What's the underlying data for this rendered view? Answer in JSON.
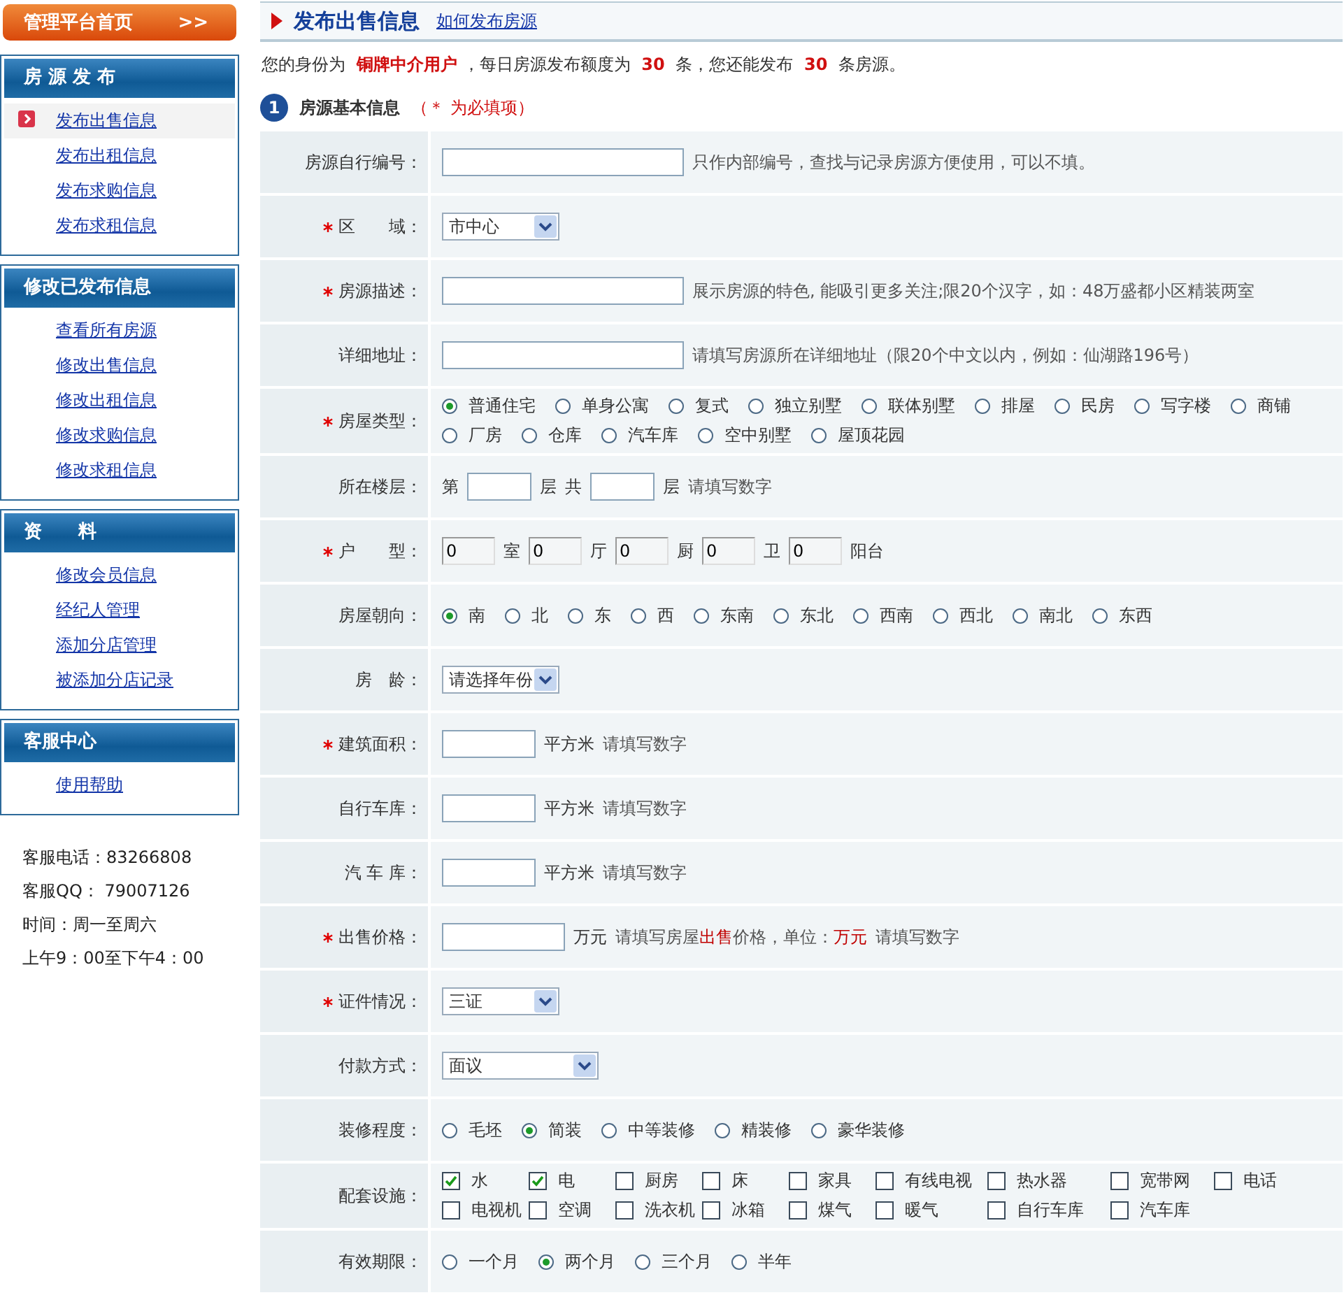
{
  "sidebar": {
    "home_button": {
      "label": "管理平台首页",
      "arrow": ">>"
    },
    "sections": [
      {
        "title": "房 源 发 布",
        "items": [
          {
            "label": "发布出售信息",
            "selected": true
          },
          {
            "label": "发布出租信息",
            "selected": false
          },
          {
            "label": "发布求购信息",
            "selected": false
          },
          {
            "label": "发布求租信息",
            "selected": false
          }
        ]
      },
      {
        "title": "修改已发布信息",
        "items": [
          {
            "label": "查看所有房源",
            "selected": false
          },
          {
            "label": "修改出售信息",
            "selected": false
          },
          {
            "label": "修改出租信息",
            "selected": false
          },
          {
            "label": "修改求购信息",
            "selected": false
          },
          {
            "label": "修改求租信息",
            "selected": false
          }
        ]
      },
      {
        "title": "资　　料",
        "items": [
          {
            "label": "修改会员信息",
            "selected": false
          },
          {
            "label": "经纪人管理",
            "selected": false
          },
          {
            "label": "添加分店管理",
            "selected": false
          },
          {
            "label": "被添加分店记录",
            "selected": false
          }
        ]
      },
      {
        "title": "客服中心",
        "items": [
          {
            "label": "使用帮助",
            "selected": false
          }
        ]
      }
    ],
    "contact": [
      "客服电话：83266808",
      "客服QQ：  79007126",
      "时间：周一至周六",
      "上午9：00至下午4：00"
    ]
  },
  "page": {
    "title": "发布出售信息",
    "help_link": "如何发布房源",
    "notice": "您的身份为 **铜牌中介用户**，每日房源发布额度为 **30** 条，您还能发布 **30** 条房源。",
    "section": {
      "number": "1",
      "title": "房源基本信息",
      "note": "（＊ 为必填项）"
    }
  },
  "form": [
    {
      "label": "房源自行编号：",
      "required": false,
      "parts": [
        {
          "kind": "wide-input"
        },
        {
          "kind": "hint",
          "text": "只作内部编号，查找与记录房源方便使用，可以不填。"
        }
      ]
    },
    {
      "label": "区　　域：",
      "required": true,
      "parts": [
        {
          "kind": "select",
          "value": "市中心"
        }
      ]
    },
    {
      "label": "房源描述：",
      "required": true,
      "parts": [
        {
          "kind": "wide-input"
        },
        {
          "kind": "hint",
          "text": "展示房源的特色, 能吸引更多关注;限20个汉字，如：48万盛都小区精装两室"
        }
      ]
    },
    {
      "label": "详细地址：",
      "required": false,
      "parts": [
        {
          "kind": "wide-input"
        },
        {
          "kind": "hint",
          "text": "请填写房源所在详细地址（限20个中文以内，例如：仙湖路196号）"
        }
      ]
    },
    {
      "label": "房屋类型：",
      "required": true,
      "parts": [
        {
          "kind": "radio",
          "options": [
            {
              "label": "普通住宅",
              "selected": true
            },
            {
              "label": "单身公寓",
              "selected": false
            },
            {
              "label": "复式",
              "selected": false
            },
            {
              "label": "独立别墅",
              "selected": false
            },
            {
              "label": "联体别墅",
              "selected": false
            },
            {
              "label": "排屋",
              "selected": false
            },
            {
              "label": "民房",
              "selected": false
            },
            {
              "label": "写字楼",
              "selected": false
            },
            {
              "label": "商铺",
              "selected": false
            },
            {
              "label": "厂房",
              "selected": false
            },
            {
              "label": "仓库",
              "selected": false
            },
            {
              "label": "汽车库",
              "selected": false
            },
            {
              "label": "空中别墅",
              "selected": false
            },
            {
              "label": "屋顶花园",
              "selected": false
            }
          ]
        }
      ]
    },
    {
      "label": "所在楼层：",
      "required": false,
      "parts": [
        {
          "kind": "text",
          "text": "第"
        },
        {
          "kind": "short-input"
        },
        {
          "kind": "text",
          "text": "层"
        },
        {
          "kind": "text",
          "text": "共"
        },
        {
          "kind": "short-input"
        },
        {
          "kind": "text",
          "text": "层"
        },
        {
          "kind": "hint",
          "text": "请填写数字"
        }
      ]
    },
    {
      "label": "户　　型：",
      "required": true,
      "parts": [
        {
          "kind": "tiny-input",
          "value": "0"
        },
        {
          "kind": "text",
          "text": "室"
        },
        {
          "kind": "tiny-input",
          "value": "0"
        },
        {
          "kind": "text",
          "text": "厅"
        },
        {
          "kind": "tiny-input",
          "value": "0"
        },
        {
          "kind": "text",
          "text": "厨"
        },
        {
          "kind": "tiny-input",
          "value": "0"
        },
        {
          "kind": "text",
          "text": "卫"
        },
        {
          "kind": "tiny-input",
          "value": "0"
        },
        {
          "kind": "text",
          "text": "阳台"
        }
      ]
    },
    {
      "label": "房屋朝向：",
      "required": false,
      "parts": [
        {
          "kind": "radio",
          "options": [
            {
              "label": "南",
              "selected": true
            },
            {
              "label": "北",
              "selected": false
            },
            {
              "label": "东",
              "selected": false
            },
            {
              "label": "西",
              "selected": false
            },
            {
              "label": "东南",
              "selected": false
            },
            {
              "label": "东北",
              "selected": false
            },
            {
              "label": "西南",
              "selected": false
            },
            {
              "label": "西北",
              "selected": false
            },
            {
              "label": "南北",
              "selected": false
            },
            {
              "label": "东西",
              "selected": false
            }
          ]
        }
      ]
    },
    {
      "label": "房　龄：",
      "required": false,
      "parts": [
        {
          "kind": "select",
          "value": "请选择年份"
        }
      ]
    },
    {
      "label": "建筑面积：",
      "required": true,
      "parts": [
        {
          "kind": "medium-input"
        },
        {
          "kind": "text",
          "text": "平方米"
        },
        {
          "kind": "hint",
          "text": "请填写数字"
        }
      ]
    },
    {
      "label": "自行车库：",
      "required": false,
      "parts": [
        {
          "kind": "medium-input"
        },
        {
          "kind": "text",
          "text": "平方米"
        },
        {
          "kind": "hint",
          "text": "请填写数字"
        }
      ]
    },
    {
      "label": "汽 车 库：",
      "required": false,
      "parts": [
        {
          "kind": "medium-input"
        },
        {
          "kind": "text",
          "text": "平方米"
        },
        {
          "kind": "hint",
          "text": "请填写数字"
        }
      ]
    },
    {
      "label": "出售价格：",
      "required": true,
      "parts": [
        {
          "kind": "price-input"
        },
        {
          "kind": "text",
          "text": "万元"
        },
        {
          "kind": "hint",
          "text": "请填写房屋**出售**价格，单位：**万元**"
        },
        {
          "kind": "hint",
          "text": "请填写数字"
        }
      ]
    },
    {
      "label": "证件情况：",
      "required": true,
      "parts": [
        {
          "kind": "select",
          "value": "三证"
        }
      ]
    },
    {
      "label": "付款方式：",
      "required": false,
      "parts": [
        {
          "kind": "wide-select",
          "value": "面议"
        }
      ]
    },
    {
      "label": "装修程度：",
      "required": false,
      "parts": [
        {
          "kind": "radio",
          "options": [
            {
              "label": "毛坯",
              "selected": false
            },
            {
              "label": "简装",
              "selected": true
            },
            {
              "label": "中等装修",
              "selected": false
            },
            {
              "label": "精装修",
              "selected": false
            },
            {
              "label": "豪华装修",
              "selected": false
            }
          ]
        }
      ]
    },
    {
      "label": "配套设施：",
      "required": false,
      "parts": [
        {
          "kind": "checkbox",
          "options": [
            {
              "label": "水",
              "checked": true
            },
            {
              "label": "电",
              "checked": true
            },
            {
              "label": "厨房",
              "checked": false
            },
            {
              "label": "床",
              "checked": false
            },
            {
              "label": "家具",
              "checked": false
            },
            {
              "label": "有线电视",
              "checked": false
            },
            {
              "label": "热水器",
              "checked": false
            },
            {
              "label": "宽带网",
              "checked": false
            },
            {
              "label": "电话",
              "checked": false
            },
            {
              "label": "电视机",
              "checked": false
            },
            {
              "label": "空调",
              "checked": false
            },
            {
              "label": "洗衣机",
              "checked": false
            },
            {
              "label": "冰箱",
              "checked": false
            },
            {
              "label": "煤气",
              "checked": false
            },
            {
              "label": "暖气",
              "checked": false
            },
            {
              "label": "自行车库",
              "checked": false
            },
            {
              "label": "汽车库",
              "checked": false
            }
          ]
        }
      ]
    },
    {
      "label": "有效期限：",
      "required": false,
      "parts": [
        {
          "kind": "radio",
          "options": [
            {
              "label": "一个月",
              "selected": false
            },
            {
              "label": "两个月",
              "selected": true
            },
            {
              "label": "三个月",
              "selected": false
            },
            {
              "label": "半年",
              "selected": false
            }
          ]
        }
      ]
    }
  ]
}
